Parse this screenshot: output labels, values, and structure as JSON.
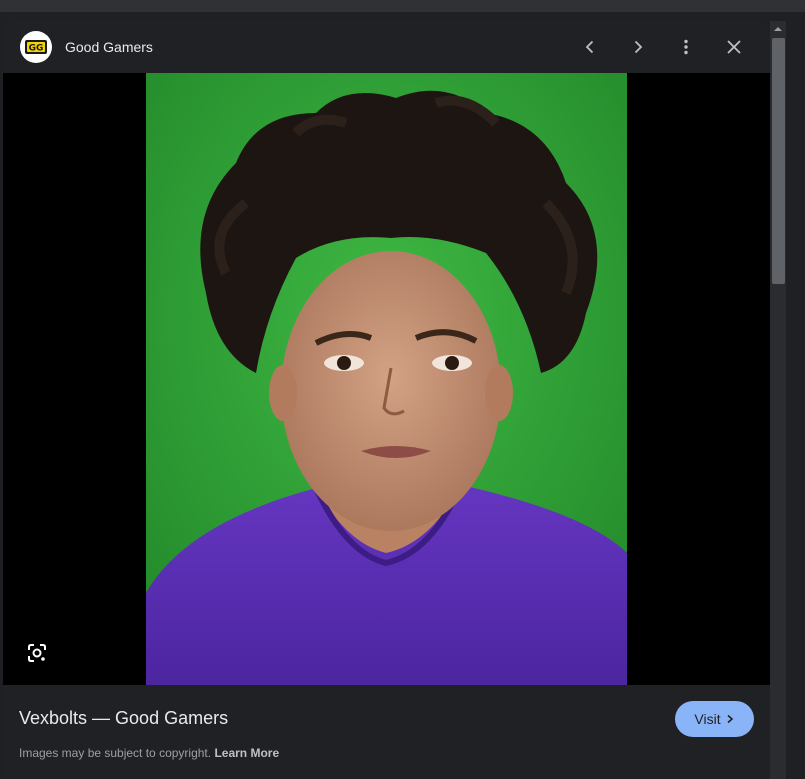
{
  "site": {
    "name": "Good Gamers",
    "logo_text": "GG",
    "logo_color": "#f5d300"
  },
  "header": {
    "prev_icon": "chevron-left-icon",
    "next_icon": "chevron-right-icon",
    "menu_icon": "more-vert-icon",
    "close_icon": "close-icon"
  },
  "image": {
    "background_color": "#2fa437",
    "shirt_color": "#5b2fb2"
  },
  "caption": {
    "title": "Vexbolts — Good Gamers",
    "visit_label": "Visit",
    "copyright_text": "Images may be subject to copyright.",
    "learn_more": "Learn More"
  },
  "lens": {
    "icon": "lens-search-icon"
  }
}
